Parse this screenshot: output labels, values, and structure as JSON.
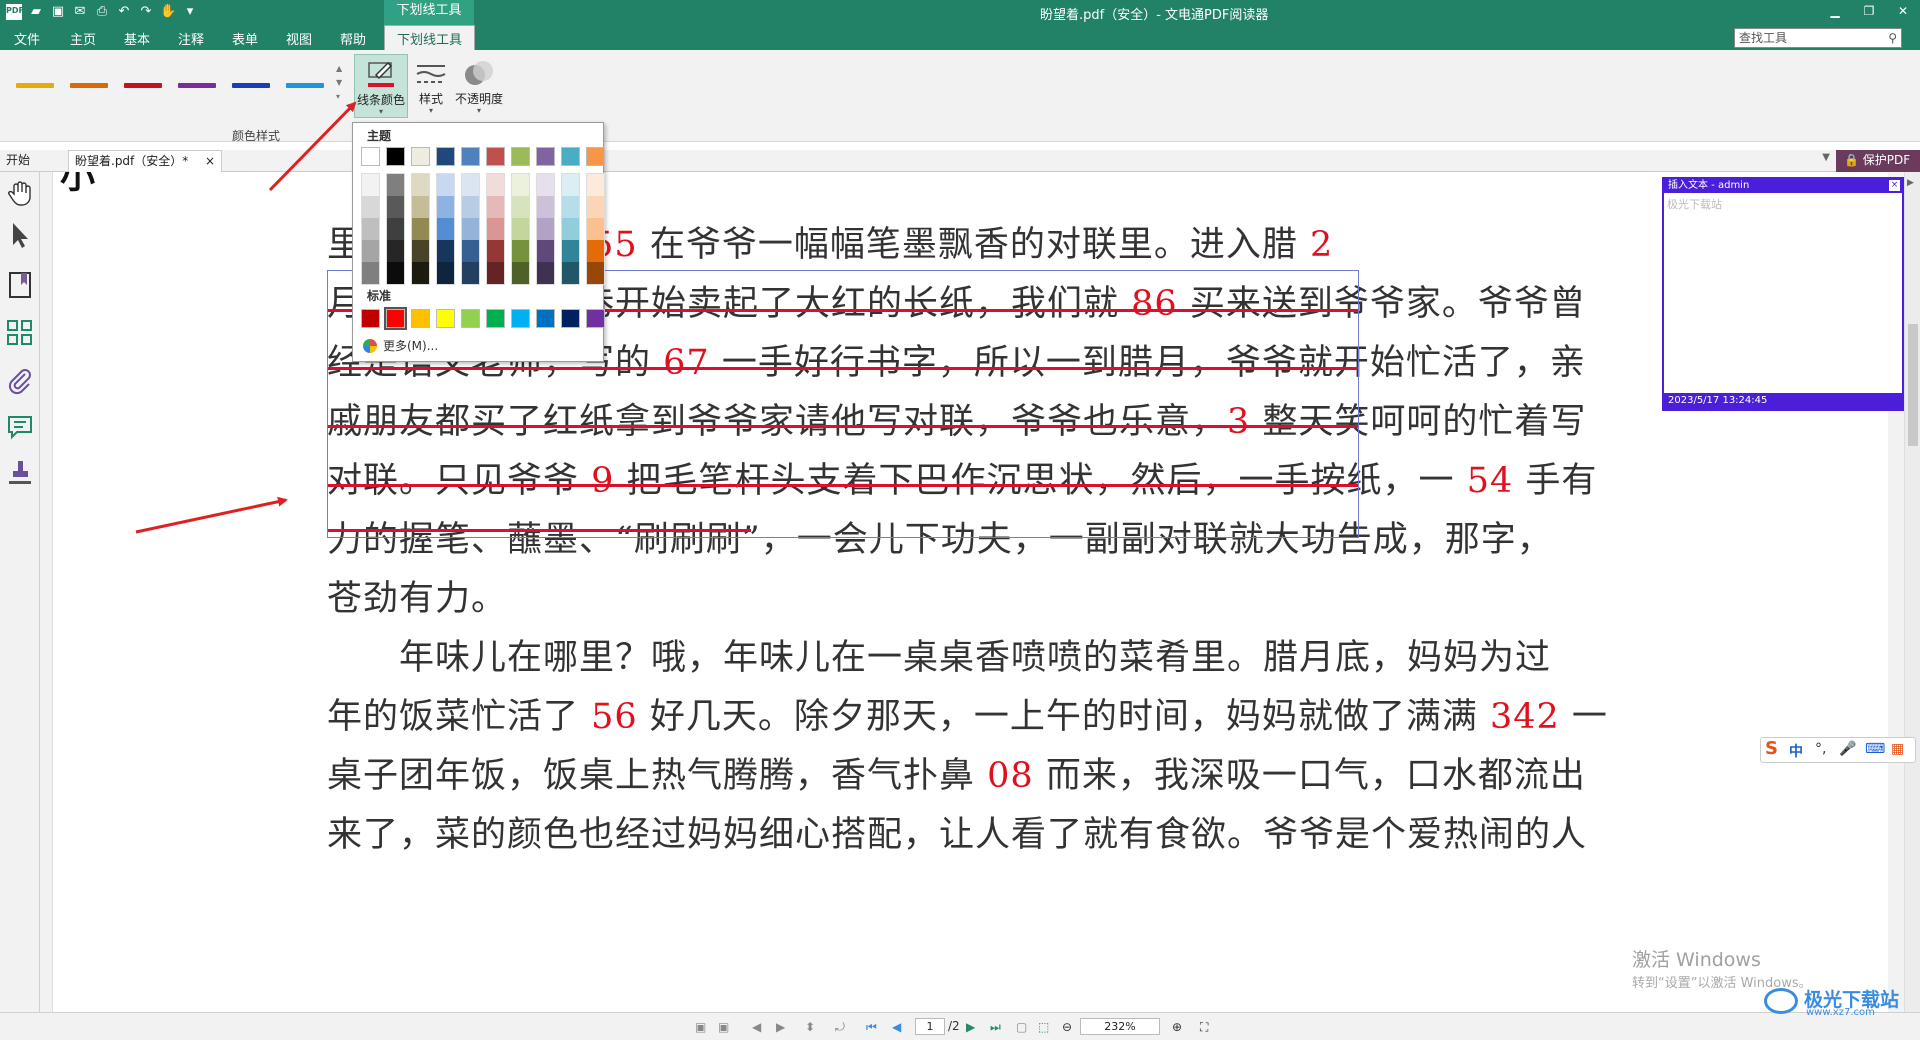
{
  "window": {
    "title": "盼望着.pdf（安全）- 文电通PDF阅读器",
    "context_tab_title": "下划线工具",
    "controls": [
      "▁",
      "❐",
      "✕"
    ]
  },
  "menu": {
    "items": [
      "文件",
      "主页",
      "基本",
      "注释",
      "表单",
      "视图",
      "帮助",
      "下划线工具"
    ],
    "active": "下划线工具",
    "search_placeholder": "查找工具"
  },
  "ribbon": {
    "line_colors": [
      "#e0ad0b",
      "#d66b0a",
      "#c3121e",
      "#7a2c9a",
      "#1a3cb4",
      "#1f96d6"
    ],
    "group_label": "颜色样式",
    "buttons": {
      "line_color": "线条颜色",
      "style": "样式",
      "opacity": "不透明度"
    }
  },
  "tabs": {
    "start": "开始",
    "document": "盼望着.pdf（安全）*",
    "close": "×",
    "protect": "保护PDF"
  },
  "document": {
    "lines": [
      {
        "segments": [
          [
            "里？哦，年味儿 ",
            false
          ],
          [
            "55",
            true
          ],
          [
            " 在爷爷一幅幅笔墨飘香的对联里。进入腊 ",
            false
          ],
          [
            "2",
            true
          ]
        ]
      },
      {
        "segments": [
          [
            "月，街上大街小巷开始卖起了大红的长纸，我们就 ",
            false
          ],
          [
            "86",
            true
          ],
          [
            " 买来送到爷爷家。爷爷曾",
            false
          ]
        ]
      },
      {
        "segments": [
          [
            "经是语文老师，写的 ",
            false
          ],
          [
            "67",
            true
          ],
          [
            " 一手好行书字，所以一到腊月，爷爷就开始忙活了，亲",
            false
          ]
        ]
      },
      {
        "segments": [
          [
            "戚朋友都买了红纸拿到爷爷家请他写对联，爷爷也乐意，",
            false
          ],
          [
            "3",
            true
          ],
          [
            " 整天笑呵呵的忙着写",
            false
          ]
        ]
      },
      {
        "segments": [
          [
            "对联。只见爷爷 ",
            false
          ],
          [
            "9",
            true
          ],
          [
            " 把毛笔杆头支着下巴作沉思状，然后，一手按纸，一 ",
            false
          ],
          [
            "54",
            true
          ],
          [
            " 手有",
            false
          ]
        ]
      },
      {
        "segments": [
          [
            "力的握笔、蘸墨、“刷刷刷”，一会儿下功夫，一副副对联就大功告成，那字，",
            false
          ]
        ]
      },
      {
        "segments": [
          [
            "苍劲有力。",
            false
          ]
        ]
      },
      {
        "segments": [
          [
            "　　年味儿在哪里？哦，年味儿在一桌桌香喷喷的菜肴里。腊月底，妈妈为过",
            false
          ]
        ]
      },
      {
        "segments": [
          [
            "年的饭菜忙活了 ",
            false
          ],
          [
            "56",
            true
          ],
          [
            " 好几天。除夕那天，一上午的时间，妈妈就做了满满 ",
            false
          ],
          [
            "342",
            true
          ],
          [
            " 一",
            false
          ]
        ]
      },
      {
        "segments": [
          [
            "桌子团年饭，饭桌上热气腾腾，香气扑鼻 ",
            false
          ],
          [
            "08",
            true
          ],
          [
            " 而来，我深吸一口气，口水都流出",
            false
          ]
        ]
      },
      {
        "segments": [
          [
            "来了，菜的颜色也经过妈妈细心搭配，让人看了就有食欲。爷爷是个爱热闹的人",
            false
          ]
        ]
      }
    ],
    "number_color": "#e0101e",
    "underline_color": "#d9102e"
  },
  "note": {
    "title": "插入文本 - admin",
    "placeholder": "极光下载站",
    "timestamp": "2023/5/17 13:24:45"
  },
  "color_dropdown": {
    "theme_label": "主题",
    "standard_label": "标准",
    "more_label": "更多(M)...",
    "theme_colors": [
      "#ffffff",
      "#000000",
      "#eeece1",
      "#1f497d",
      "#4f81bd",
      "#c0504d",
      "#9bbb59",
      "#8064a2",
      "#4bacc6",
      "#f79646"
    ],
    "theme_shades": [
      [
        "#f2f2f2",
        "#d8d8d8",
        "#bfbfbf",
        "#a5a5a5",
        "#7f7f7f"
      ],
      [
        "#7f7f7f",
        "#595959",
        "#3f3f3f",
        "#262626",
        "#0c0c0c"
      ],
      [
        "#ddd9c3",
        "#c4bd97",
        "#938953",
        "#494429",
        "#1d1b10"
      ],
      [
        "#c6d9f0",
        "#8db3e2",
        "#548dd4",
        "#17365d",
        "#0f243e"
      ],
      [
        "#dbe5f1",
        "#b8cce4",
        "#95b3d7",
        "#366092",
        "#244061"
      ],
      [
        "#f2dcdb",
        "#e5b9b7",
        "#d99694",
        "#953734",
        "#632423"
      ],
      [
        "#ebf1dd",
        "#d7e3bc",
        "#c3d69b",
        "#76923c",
        "#4f6128"
      ],
      [
        "#e5e0ec",
        "#ccc1d9",
        "#b2a2c7",
        "#5f497a",
        "#3f3151"
      ],
      [
        "#dbeef3",
        "#b7dde8",
        "#92cddc",
        "#31859b",
        "#205867"
      ],
      [
        "#fdeada",
        "#fbd5b5",
        "#fac08f",
        "#e36c09",
        "#974806"
      ]
    ],
    "standard_colors": [
      "#c00000",
      "#ff0000",
      "#ffc000",
      "#ffff00",
      "#92d050",
      "#00b050",
      "#00b0f0",
      "#0070c0",
      "#002060",
      "#7030a0"
    ],
    "selected_standard": 1
  },
  "statusbar": {
    "page": "1",
    "page_total": "/2",
    "zoom": "232%"
  },
  "ime": {
    "lang": "中"
  },
  "watermark": {
    "activate_title": "激活 Windows",
    "activate_hint": "转到“设置”以激活 Windows。",
    "brand_name": "极光下载站",
    "brand_url": "www.xz7.com"
  },
  "annotations": {
    "arrow_color": "#e02020"
  }
}
